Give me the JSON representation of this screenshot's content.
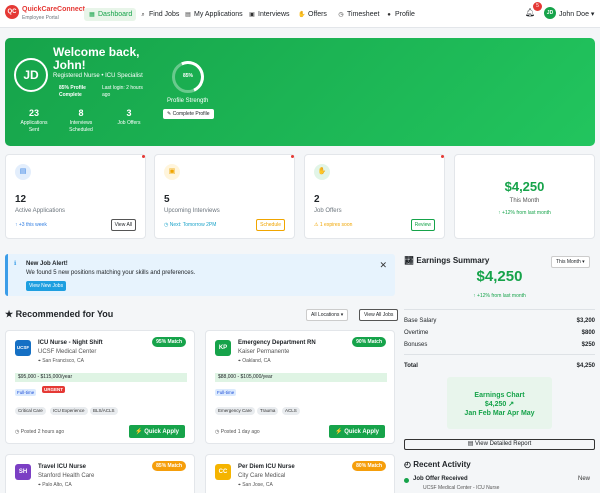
{
  "brand": {
    "logo_text": "QC",
    "name": "QuickCareConnect",
    "subtitle": "Employee Portal"
  },
  "nav": {
    "items": [
      {
        "label": "Dashboard",
        "icon": "grid-icon",
        "active": true
      },
      {
        "label": "Find Jobs",
        "icon": "search-icon"
      },
      {
        "label": "My Applications",
        "icon": "file-icon"
      },
      {
        "label": "Interviews",
        "icon": "calendar-icon"
      },
      {
        "label": "Offers",
        "icon": "handshake-icon"
      },
      {
        "label": "Timesheet",
        "icon": "clock-icon"
      },
      {
        "label": "Profile",
        "icon": "user-icon"
      }
    ],
    "notifications": "5",
    "user_initials": "JD",
    "user_name": "John Doe"
  },
  "hero": {
    "initials": "JD",
    "welcome": "Welcome back,",
    "name_line": "John!",
    "role": "Registered Nurse • ICU Specialist",
    "profile_complete_1": "85% Profile",
    "profile_complete_2": "Complete",
    "last_login_1": "Last login: 2 hours",
    "last_login_2": "ago",
    "stats": [
      {
        "value": "23",
        "label1": "Applications",
        "label2": "Sent"
      },
      {
        "value": "8",
        "label1": "Interviews",
        "label2": "Scheduled"
      },
      {
        "value": "3",
        "label1": "Job Offers",
        "label2": ""
      }
    ],
    "strength_pct": "85%",
    "strength_value": 0.85,
    "strength_label": "Profile Strength",
    "complete_btn": "Complete Profile"
  },
  "stat_cards": [
    {
      "value": "12",
      "label": "Active Applications",
      "sub": "+3 this week",
      "btn": "View All",
      "icon": "file-icon",
      "color": "#2f7de1"
    },
    {
      "value": "5",
      "label": "Upcoming Interviews",
      "sub": "Next: Tomorrow 2PM",
      "btn": "Schedule",
      "icon": "calendar-icon",
      "color": "#f0a500"
    },
    {
      "value": "2",
      "label": "Job Offers",
      "sub": "1 expires soon",
      "btn": "Review",
      "icon": "handshake-icon",
      "color": "#16a34a"
    }
  ],
  "month_card": {
    "value": "$4,250",
    "label": "This Month",
    "sub": "+12% from last month"
  },
  "alert": {
    "title": "New Job Alert!",
    "text": "We found 5 new positions matching your skills and preferences.",
    "button": "View New Jobs"
  },
  "recommended": {
    "title": "Recommended for You",
    "filter": "All Locations",
    "view_all": "View All Jobs",
    "jobs": [
      {
        "logo": "UCSF",
        "logo_color": "#1570c4",
        "title": "ICU Nurse - Night Shift",
        "org": "UCSF Medical Center",
        "location": "San Francisco, CA",
        "match": "95% Match",
        "match_color": "#16a34a",
        "salary": "$95,000 - $115,000/year",
        "type": "Full-time",
        "urgent": "URGENT",
        "chips": [
          "Critical Care",
          "ICU Experience",
          "BLS/ACLS"
        ],
        "posted": "Posted 2 hours ago",
        "apply": "Quick Apply"
      },
      {
        "logo": "KP",
        "logo_color": "#16a34a",
        "title": "Emergency Department RN",
        "org": "Kaiser Permanente",
        "location": "Oakland, CA",
        "match": "90% Match",
        "match_color": "#16a34a",
        "salary": "$88,000 - $105,000/year",
        "type": "Full-time",
        "urgent": "",
        "chips": [
          "Emergency Care",
          "Trauma",
          "ACLS"
        ],
        "posted": "Posted 1 day ago",
        "apply": "Quick Apply"
      },
      {
        "logo": "SH",
        "logo_color": "#7b3fc4",
        "title": "Travel ICU Nurse",
        "org": "Stanford Health Care",
        "location": "Palo Alto, CA",
        "match": "85% Match",
        "match_color": "#f59e0b"
      },
      {
        "logo": "CC",
        "logo_color": "#f5b400",
        "title": "Per Diem ICU Nurse",
        "org": "City Care Medical",
        "location": "San Jose, CA",
        "match": "80% Match",
        "match_color": "#f59e0b"
      }
    ]
  },
  "earnings": {
    "title": "Earnings Summary",
    "period": "This Month",
    "total": "$4,250",
    "change": "+12% from last month",
    "rows": [
      {
        "label": "Base Salary",
        "value": "$3,200"
      },
      {
        "label": "Overtime",
        "value": "$800"
      },
      {
        "label": "Bonuses",
        "value": "$250"
      }
    ],
    "total_label": "Total",
    "total_value": "$4,250",
    "chart_title": "Earnings Chart",
    "chart_value": "$4,250 ↗",
    "chart_months": "Jan Feb Mar Apr May",
    "report_btn": "View Detailed Report"
  },
  "activity": {
    "title": "Recent Activity",
    "item_title": "Job Offer Received",
    "item_badge": "New",
    "item_sub": "UCSF Medical Center - ICU Nurse"
  }
}
